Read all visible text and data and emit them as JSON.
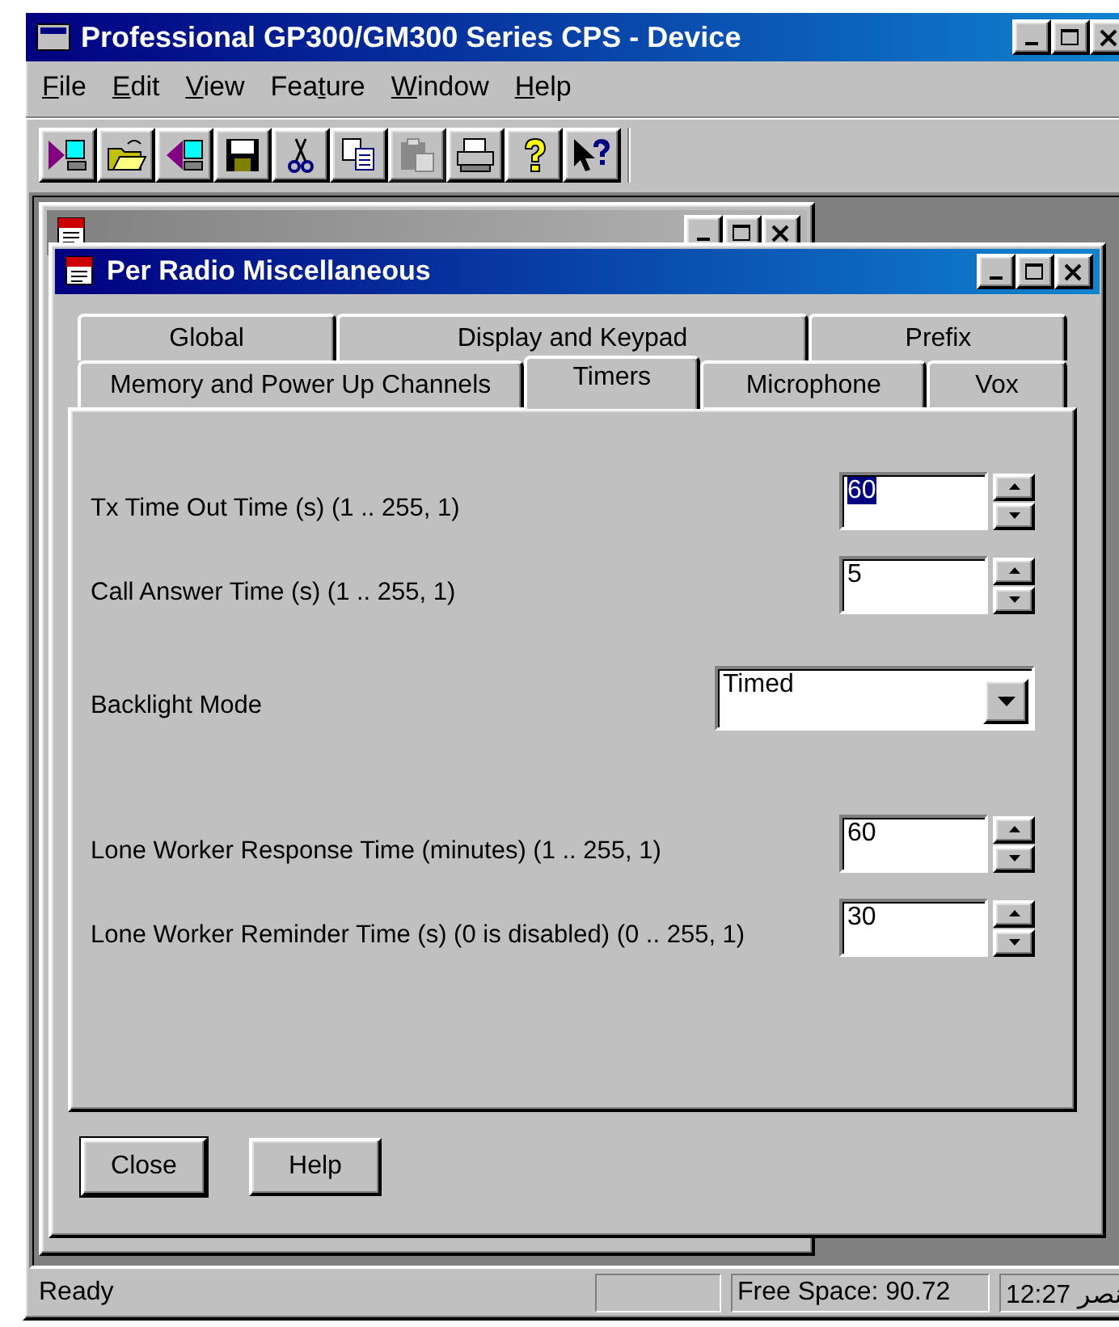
{
  "window": {
    "title": "Professional GP300/GM300 Series CPS - Device"
  },
  "menu": [
    {
      "key": "F",
      "rest": "ile"
    },
    {
      "key": "E",
      "rest": "dit"
    },
    {
      "key": "V",
      "rest": "iew"
    },
    {
      "lead": "Fea",
      "key": "t",
      "rest": "ure"
    },
    {
      "key": "W",
      "rest": "indow"
    },
    {
      "key": "H",
      "rest": "elp"
    }
  ],
  "toolbar": [
    {
      "kind": "read",
      "disabled": false
    },
    {
      "kind": "open",
      "disabled": false
    },
    {
      "kind": "write",
      "disabled": false
    },
    {
      "kind": "save",
      "disabled": false
    },
    {
      "kind": "cut",
      "disabled": false
    },
    {
      "kind": "copy",
      "disabled": false
    },
    {
      "kind": "paste",
      "disabled": true
    },
    {
      "kind": "print",
      "disabled": false
    },
    {
      "kind": "help",
      "disabled": false
    },
    {
      "kind": "context-help",
      "disabled": false
    }
  ],
  "dialog": {
    "title": "Per Radio Miscellaneous",
    "tab_rows": [
      [
        {
          "label": "Global",
          "selected": false
        },
        {
          "label": "Display and Keypad",
          "selected": false
        },
        {
          "label": "Prefix",
          "selected": false
        }
      ],
      [
        {
          "label": "Memory and Power Up Channels",
          "selected": false
        },
        {
          "label": "Timers",
          "selected": true
        },
        {
          "label": "Microphone",
          "selected": false
        },
        {
          "label": "Vox",
          "selected": false
        }
      ]
    ],
    "fields": [
      {
        "kind": "spin",
        "label": "Tx Time Out Time (s) (1 .. 255, 1)",
        "value": "60",
        "highlighted": true
      },
      {
        "kind": "spin",
        "label": "Call Answer Time (s) (1 .. 255, 1)",
        "value": "5",
        "highlighted": false
      },
      {
        "kind": "combo",
        "label": "Backlight Mode",
        "value": "Timed",
        "highlighted": false
      },
      {
        "kind": "spin",
        "label": "Lone Worker Response Time (minutes) (1 .. 255, 1)",
        "value": "60",
        "highlighted": false
      },
      {
        "kind": "spin",
        "label": "Lone Worker Reminder Time (s) (0 is disabled) (0 .. 255, 1)",
        "value": "30",
        "highlighted": false
      }
    ],
    "buttons": [
      {
        "label": "Close",
        "default": true
      },
      {
        "label": "Help",
        "default": false
      }
    ]
  },
  "status_bar": {
    "message": "Ready",
    "panes": [
      "Free Space: 90.72",
      "12:27 نصر"
    ]
  }
}
